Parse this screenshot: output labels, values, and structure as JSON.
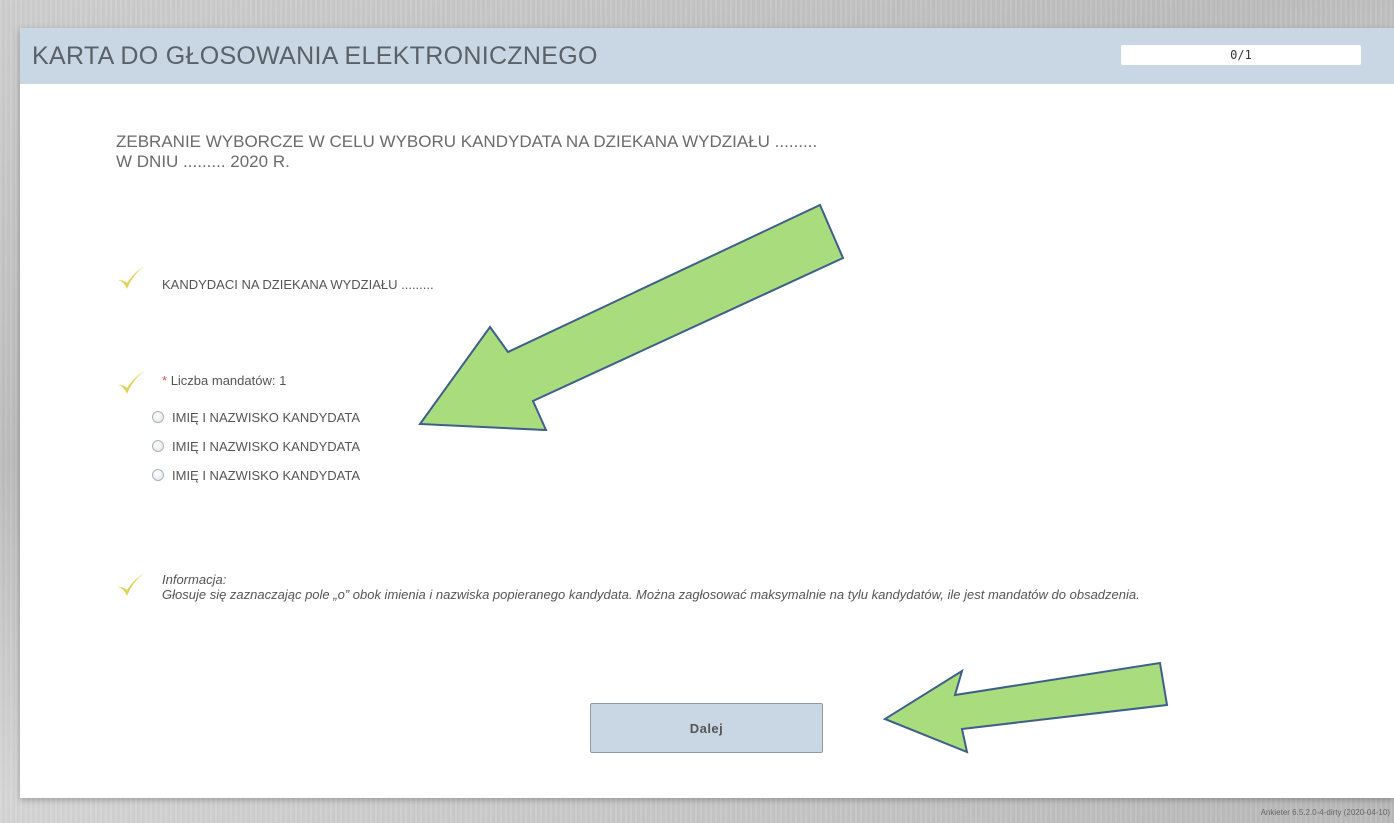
{
  "header": {
    "title": "KARTA DO GŁOSOWANIA ELEKTRONICZNEGO",
    "progress": "0/1"
  },
  "main_heading": {
    "line1": "ZEBRANIE WYBORCZE W CELU WYBORU KANDYDATA NA DZIEKANA WYDZIAŁU .........",
    "line2": "W DNIU ......... 2020 R."
  },
  "section_label": "KANDYDACI NA DZIEKANA WYDZIAŁU .........",
  "question": {
    "required_mark": "*",
    "label": "Liczba mandatów: 1",
    "options": [
      "IMIĘ I NAZWISKO KANDYDATA",
      "IMIĘ I NAZWISKO KANDYDATA",
      "IMIĘ I NAZWISKO KANDYDATA"
    ]
  },
  "info": {
    "title": "Informacja:",
    "text": "Głosuje się zaznaczając pole „o” obok imienia i nazwiska popieranego kandydata. Można zagłosować maksymalnie na tylu kandydatów, ile jest mandatów do obsadzenia."
  },
  "next_button": "Dalej",
  "footer": "Ankieter 6.5.2.0-4-dirty (2020-04-10)",
  "colors": {
    "header_bg": "#c9d6e3",
    "check": "#e1d35a",
    "arrow_fill": "#a9dc7c",
    "arrow_stroke": "#3d5f8a"
  }
}
